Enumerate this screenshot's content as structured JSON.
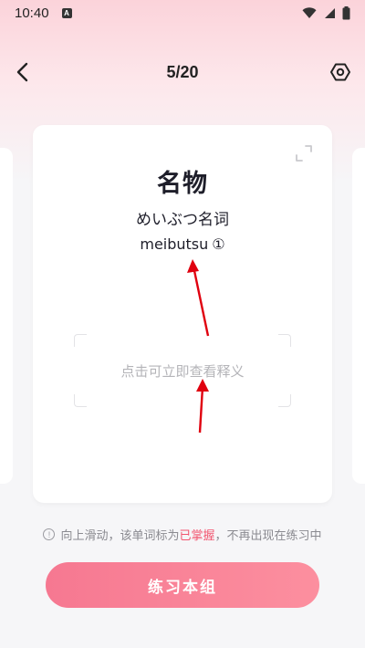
{
  "status_bar": {
    "time": "10:40",
    "a_icon_letter": "A",
    "icons": [
      "a-notification-icon",
      "wifi-icon",
      "cellular-signal-icon",
      "battery-icon"
    ]
  },
  "header": {
    "counter": "5/20",
    "back_icon": "chevron-left-icon",
    "settings_icon": "hexagon-gear-icon"
  },
  "card": {
    "word": "名物",
    "reading": "めいぶつ名词",
    "romaji": "meibutsu",
    "tone": "①",
    "reveal_hint": "点击可立即查看释义",
    "expand_icon": "expand-corners-icon"
  },
  "tip": {
    "icon_symbol": "!",
    "prefix": "向上滑动，该单词标为",
    "highlight": "已掌握",
    "suffix": "，不再出现在练习中"
  },
  "actions": {
    "practice_label": "练习本组"
  },
  "colors": {
    "accent": "#f2546e",
    "button_start": "#f67891",
    "button_end": "#fc8f9f",
    "arrow": "#e0000f",
    "header_pink": "#fbd3da"
  }
}
